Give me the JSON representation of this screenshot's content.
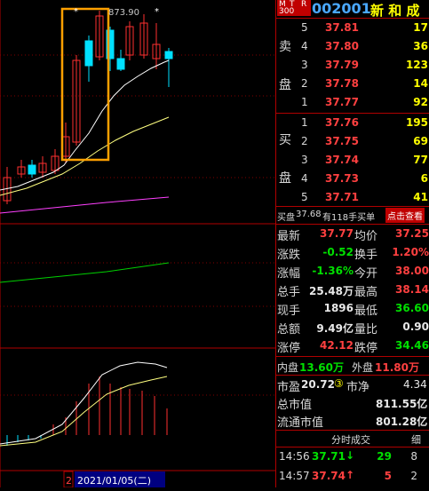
{
  "header": {
    "badge": [
      "M",
      "T",
      "R",
      "300"
    ],
    "code": "002001",
    "name": "新 和 成"
  },
  "sell": {
    "side_chars": [
      "卖",
      "盘"
    ],
    "rows": [
      {
        "level": "5",
        "price": "37.81",
        "vol": "17"
      },
      {
        "level": "4",
        "price": "37.80",
        "vol": "36"
      },
      {
        "level": "3",
        "price": "37.79",
        "vol": "123"
      },
      {
        "level": "2",
        "price": "37.78",
        "vol": "14"
      },
      {
        "level": "1",
        "price": "37.77",
        "vol": "92"
      }
    ]
  },
  "buy": {
    "side_chars": [
      "买",
      "盘"
    ],
    "rows": [
      {
        "level": "1",
        "price": "37.76",
        "vol": "195"
      },
      {
        "level": "2",
        "price": "37.75",
        "vol": "69"
      },
      {
        "level": "3",
        "price": "37.74",
        "vol": "77"
      },
      {
        "level": "4",
        "price": "37.73",
        "vol": "6"
      },
      {
        "level": "5",
        "price": "37.71",
        "vol": "41"
      }
    ]
  },
  "notice": {
    "text_a": "买盘",
    "price": "37.68",
    "text_b": "有118手买单",
    "button": "点击查看"
  },
  "quote": {
    "rows": [
      {
        "k1": "最新",
        "v1": "37.77",
        "k2": "均价",
        "v2": "37.25"
      },
      {
        "k1": "涨跌",
        "v1": "-0.52",
        "k2": "换手",
        "v2": "1.20%"
      },
      {
        "k1": "涨幅",
        "v1": "-1.36%",
        "k2": "今开",
        "v2": "38.00"
      },
      {
        "k1": "总手",
        "v1": "25.48万",
        "k2": "最高",
        "v2": "38.14"
      },
      {
        "k1": "现手",
        "v1": "1896",
        "k2": "最低",
        "v2": "36.60"
      },
      {
        "k1": "总额",
        "v1": "9.49亿",
        "k2": "量比",
        "v2": "0.90"
      },
      {
        "k1": "涨停",
        "v1": "42.12",
        "k2": "跌停",
        "v2": "34.46"
      }
    ],
    "inner_label": "内盘",
    "inner_value": "13.60万",
    "outer_label": "外盘",
    "outer_value": "11.80万",
    "shiying_label": "市盈",
    "shiying_value": "20.72",
    "shiying_mark": "③",
    "shijing_label": "市净",
    "shijing_value": "4.34",
    "total_cap_label": "总市值",
    "total_cap_value": "811.55亿",
    "float_cap_label": "流通市值",
    "float_cap_value": "801.28亿"
  },
  "ticks": {
    "tab_label": "分时成交",
    "tab_detail": "细",
    "rows": [
      {
        "time": "14:56",
        "price": "37.71",
        "dir": "↓",
        "vol": "29",
        "n": "8"
      },
      {
        "time": "14:57",
        "price": "37.74",
        "dir": "↑",
        "vol": "5",
        "n": "2"
      }
    ]
  },
  "chart": {
    "high_label": "873.90",
    "star": "*",
    "date_label": "2021/01/05(二)",
    "date_prefix": "2"
  },
  "colors": {
    "up": "#ff3030",
    "down": "#00e0ff",
    "highlight_box": "#ffa000",
    "ma1": "#ffffff",
    "ma2": "#ffff80",
    "ma3": "#ff00ff",
    "ma4": "#00ff00"
  }
}
